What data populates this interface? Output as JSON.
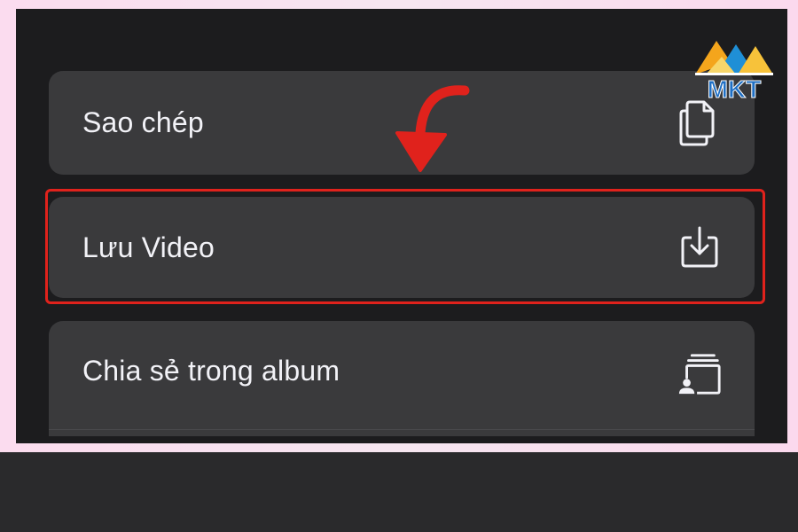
{
  "menu": {
    "items": [
      {
        "label": "Sao chép",
        "icon": "copy-icon"
      },
      {
        "label": "Lưu Video",
        "icon": "save-download-icon",
        "highlighted": true
      },
      {
        "label": "Chia sẻ trong album",
        "icon": "shared-album-icon"
      }
    ]
  },
  "annotation": {
    "arrow": "red-curved-arrow",
    "highlight_color": "#e0221c"
  },
  "watermark": {
    "text": "MKT"
  },
  "colors": {
    "screen_bg": "#1c1c1e",
    "item_bg": "#3a3a3c",
    "text": "#f2f2f7",
    "frame_bg": "#fbdcef",
    "accent": "#e0221c"
  }
}
